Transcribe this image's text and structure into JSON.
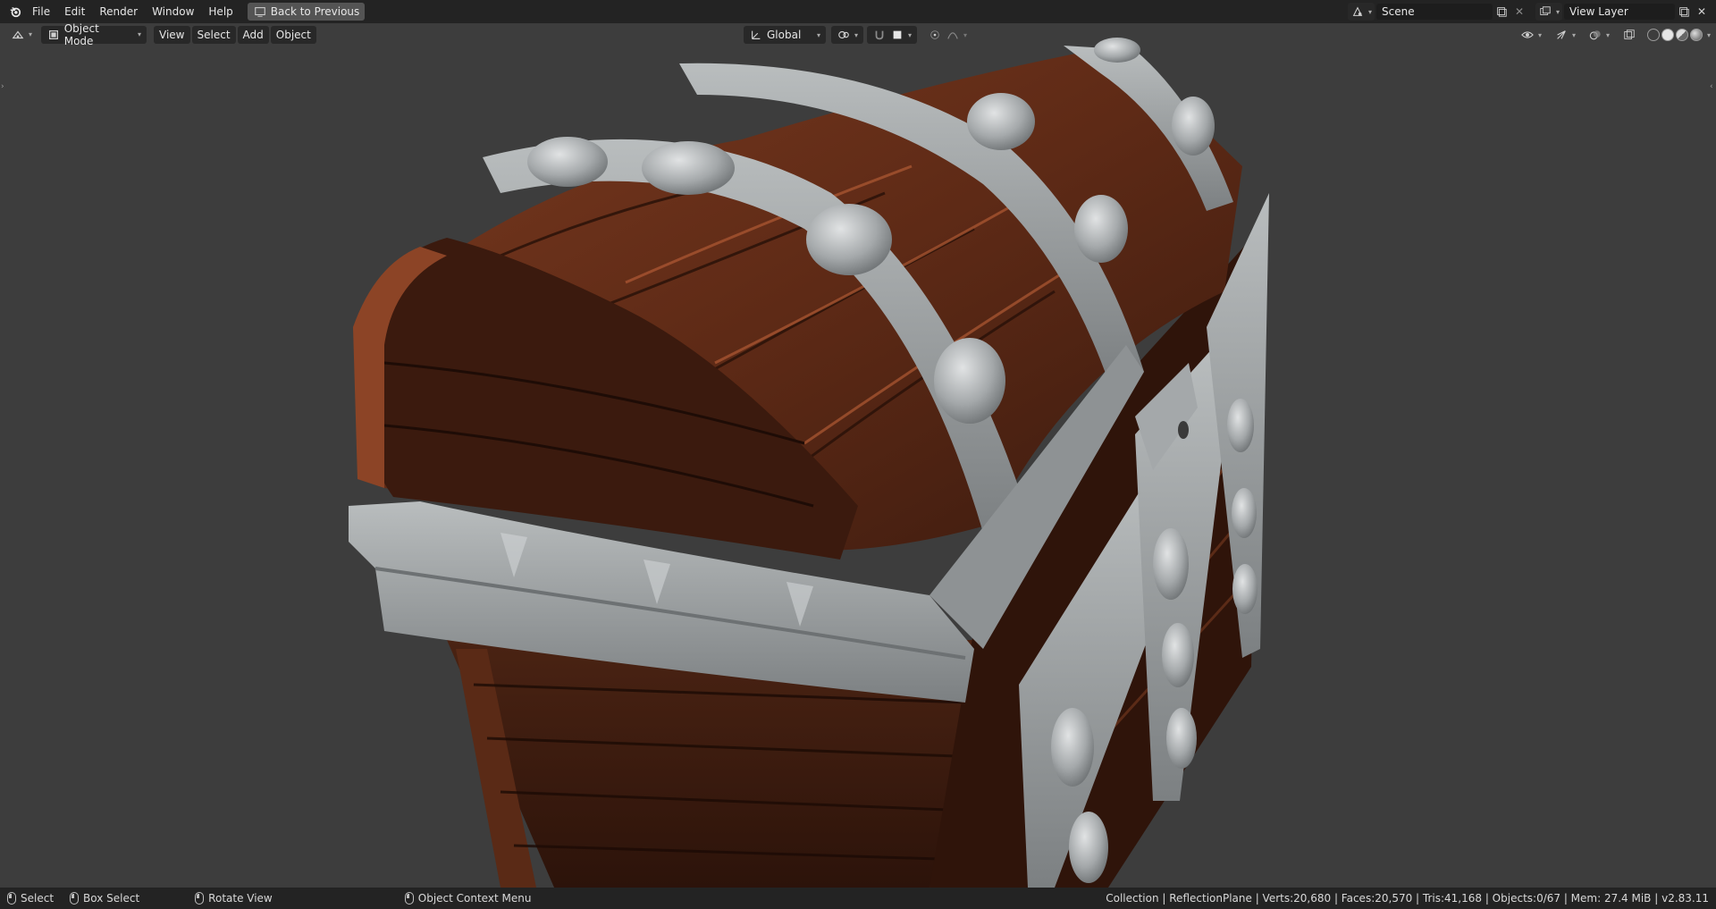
{
  "topbar": {
    "menus": [
      "File",
      "Edit",
      "Render",
      "Window",
      "Help"
    ],
    "back_button": "Back to Previous",
    "scene_name": "Scene",
    "view_layer": "View Layer"
  },
  "header": {
    "mode": "Object Mode",
    "menus": [
      "View",
      "Select",
      "Add",
      "Object"
    ],
    "transform_orientation": "Global"
  },
  "statusbar": {
    "items": [
      {
        "key": "left-mouse",
        "label": "Select"
      },
      {
        "key": "left-mouse-drag",
        "label": "Box Select"
      },
      {
        "key": "middle-mouse",
        "label": "Rotate View"
      },
      {
        "key": "right-mouse",
        "label": "Object Context Menu"
      }
    ],
    "stats": "Collection | ReflectionPlane | Verts:20,680 | Faces:20,570 | Tris:41,168 | Objects:0/67 | Mem: 27.4 MiB | v2.83.11"
  },
  "colors": {
    "wood_light": "#8a3f22",
    "wood_dark": "#3a1b10",
    "metal": "#9fa3a4",
    "background": "#3d3d3d"
  },
  "icons": [
    "blender-logo-icon",
    "editor-type-icon",
    "object-mode-icon",
    "global-axis-icon",
    "pivot-icon",
    "snap-icon",
    "proportional-edit-icon",
    "visibility-icon",
    "gizmo-icon",
    "overlay-icon",
    "xray-icon",
    "shading-icon"
  ]
}
